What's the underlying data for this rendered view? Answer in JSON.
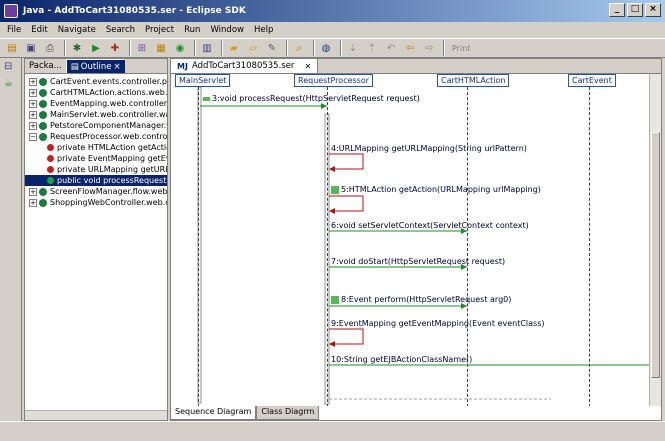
{
  "window": {
    "title": "Java - AddToCart31080535.ser - Eclipse SDK",
    "controls": [
      "_",
      "□",
      "×"
    ]
  },
  "menu": [
    "File",
    "Edit",
    "Navigate",
    "Search",
    "Project",
    "Run",
    "Window",
    "Help"
  ],
  "toolbar": {
    "print_label": "Print"
  },
  "outline": {
    "tabs": [
      {
        "label": "Packa..."
      },
      {
        "label": "Outline"
      }
    ],
    "items": [
      {
        "label": "CartEvent.events.controller.petst",
        "kind": "class"
      },
      {
        "label": "CartHTMLAction.actions.web.cont",
        "kind": "class"
      },
      {
        "label": "EventMapping.web.controller.waf",
        "kind": "class"
      },
      {
        "label": "MainServlet.web.controller.waf.bl",
        "kind": "class"
      },
      {
        "label": "PetstoreComponentManager.web",
        "kind": "class"
      },
      {
        "label": "RequestProcessor.web.controller.",
        "kind": "class-open"
      },
      {
        "label": "private HTMLAction getAction",
        "kind": "method"
      },
      {
        "label": "private EventMapping getEver",
        "kind": "method"
      },
      {
        "label": "private URLMapping getURLMa",
        "kind": "method"
      },
      {
        "label": "public void processRequest(Htt",
        "kind": "method-selected"
      },
      {
        "label": "ScreenFlowManager.flow.web.co",
        "kind": "class"
      },
      {
        "label": "ShoppingWebController.web.cont",
        "kind": "class"
      }
    ]
  },
  "editor": {
    "tab_label": "AddToCart31080535.ser",
    "lifelines": [
      "MainServlet",
      "RequestProcessor",
      "CartHTMLAction",
      "CartEvent"
    ],
    "messages": [
      {
        "label": "3:void processRequest(HttpServletRequest request)"
      },
      {
        "label": "4:URLMapping getURLMapping(String urlPattern)"
      },
      {
        "label": "5:HTMLAction getAction(URLMapping urlMapping)"
      },
      {
        "label": "6:void setServletContext(ServletContext context)"
      },
      {
        "label": "7:void doStart(HttpServletRequest request)"
      },
      {
        "label": "8:Event perform(HttpServletRequest arg0)"
      },
      {
        "label": "9:EventMapping getEventMapping(Event eventClass)"
      },
      {
        "label": "10:String getEJBActionClassName()"
      }
    ],
    "bottom_tabs": [
      "Sequence Diagram",
      "Class Diagrm"
    ]
  },
  "colors": {
    "title_bar": "#0a246a",
    "message_arrow": "#1f8a2a",
    "lifeline_border": "#3050a0"
  }
}
